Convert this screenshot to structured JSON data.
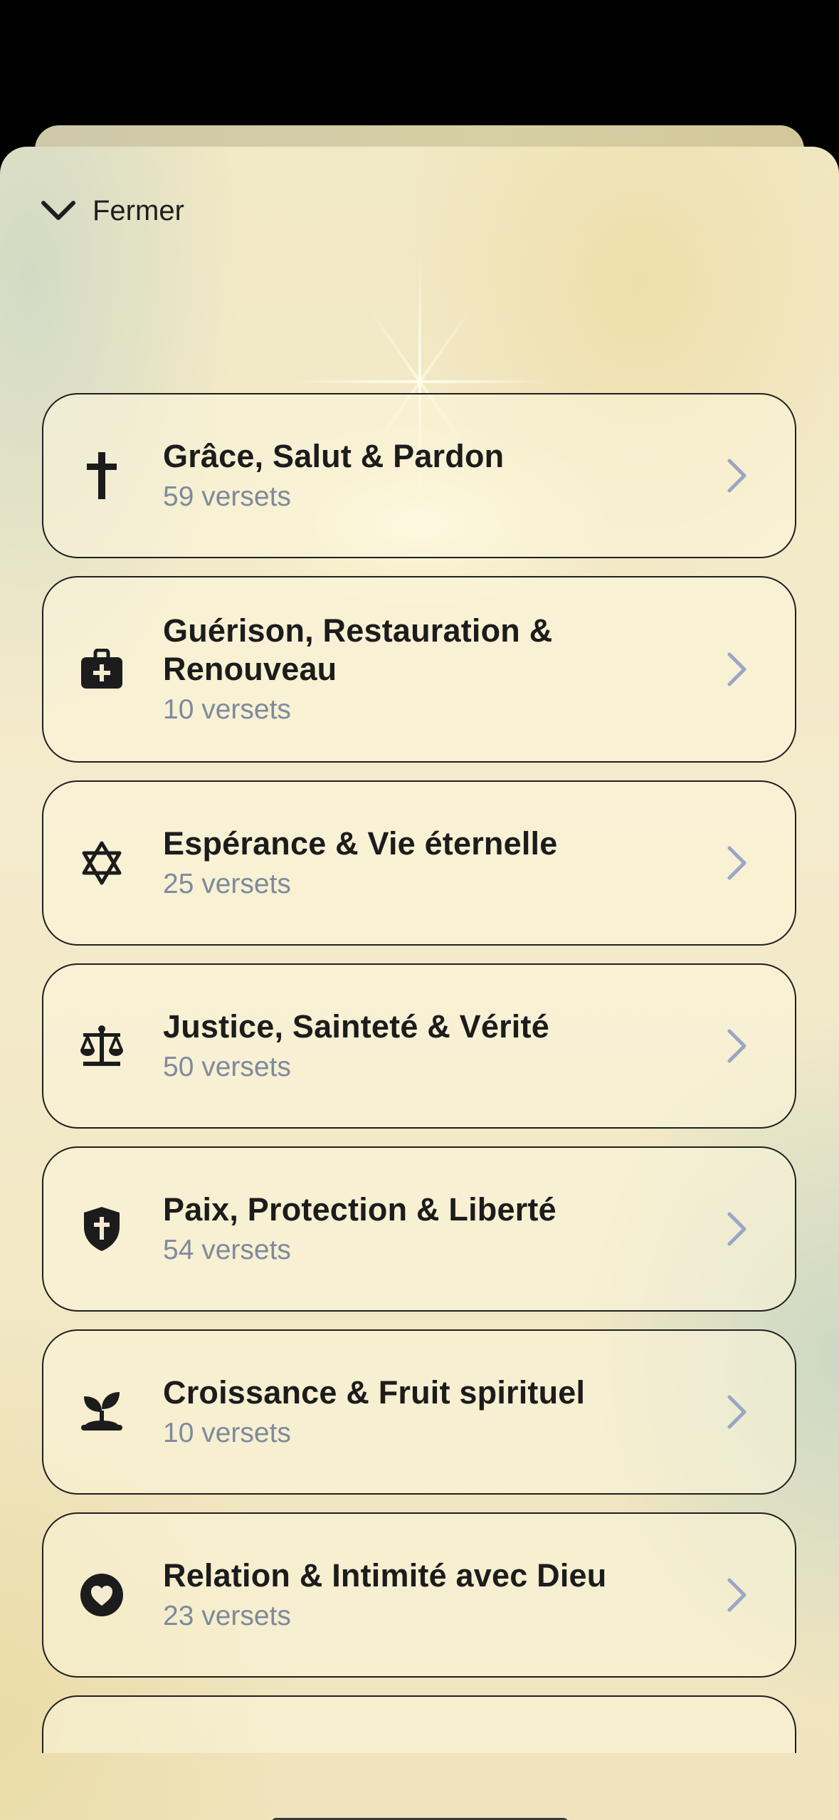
{
  "header": {
    "close_label": "Fermer"
  },
  "categories": [
    {
      "title": "Grâce, Salut & Pardon",
      "count": "59 versets",
      "icon": "cross-icon"
    },
    {
      "title": "Guérison, Restauration & Renouveau",
      "count": "10 versets",
      "icon": "medical-kit-icon"
    },
    {
      "title": "Espérance & Vie éternelle",
      "count": "25 versets",
      "icon": "star-of-david-icon"
    },
    {
      "title": "Justice, Sainteté & Vérité",
      "count": "50 versets",
      "icon": "scales-icon"
    },
    {
      "title": "Paix, Protection & Liberté",
      "count": "54 versets",
      "icon": "shield-cross-icon"
    },
    {
      "title": "Croissance & Fruit spirituel",
      "count": "10 versets",
      "icon": "sprout-icon"
    },
    {
      "title": "Relation & Intimité avec Dieu",
      "count": "23 versets",
      "icon": "heart-circle-icon"
    }
  ],
  "colors": {
    "title": "#1c1c1c",
    "count": "#7e8a9c",
    "chevron": "#9aa6c4",
    "border": "#1f1f1f"
  }
}
